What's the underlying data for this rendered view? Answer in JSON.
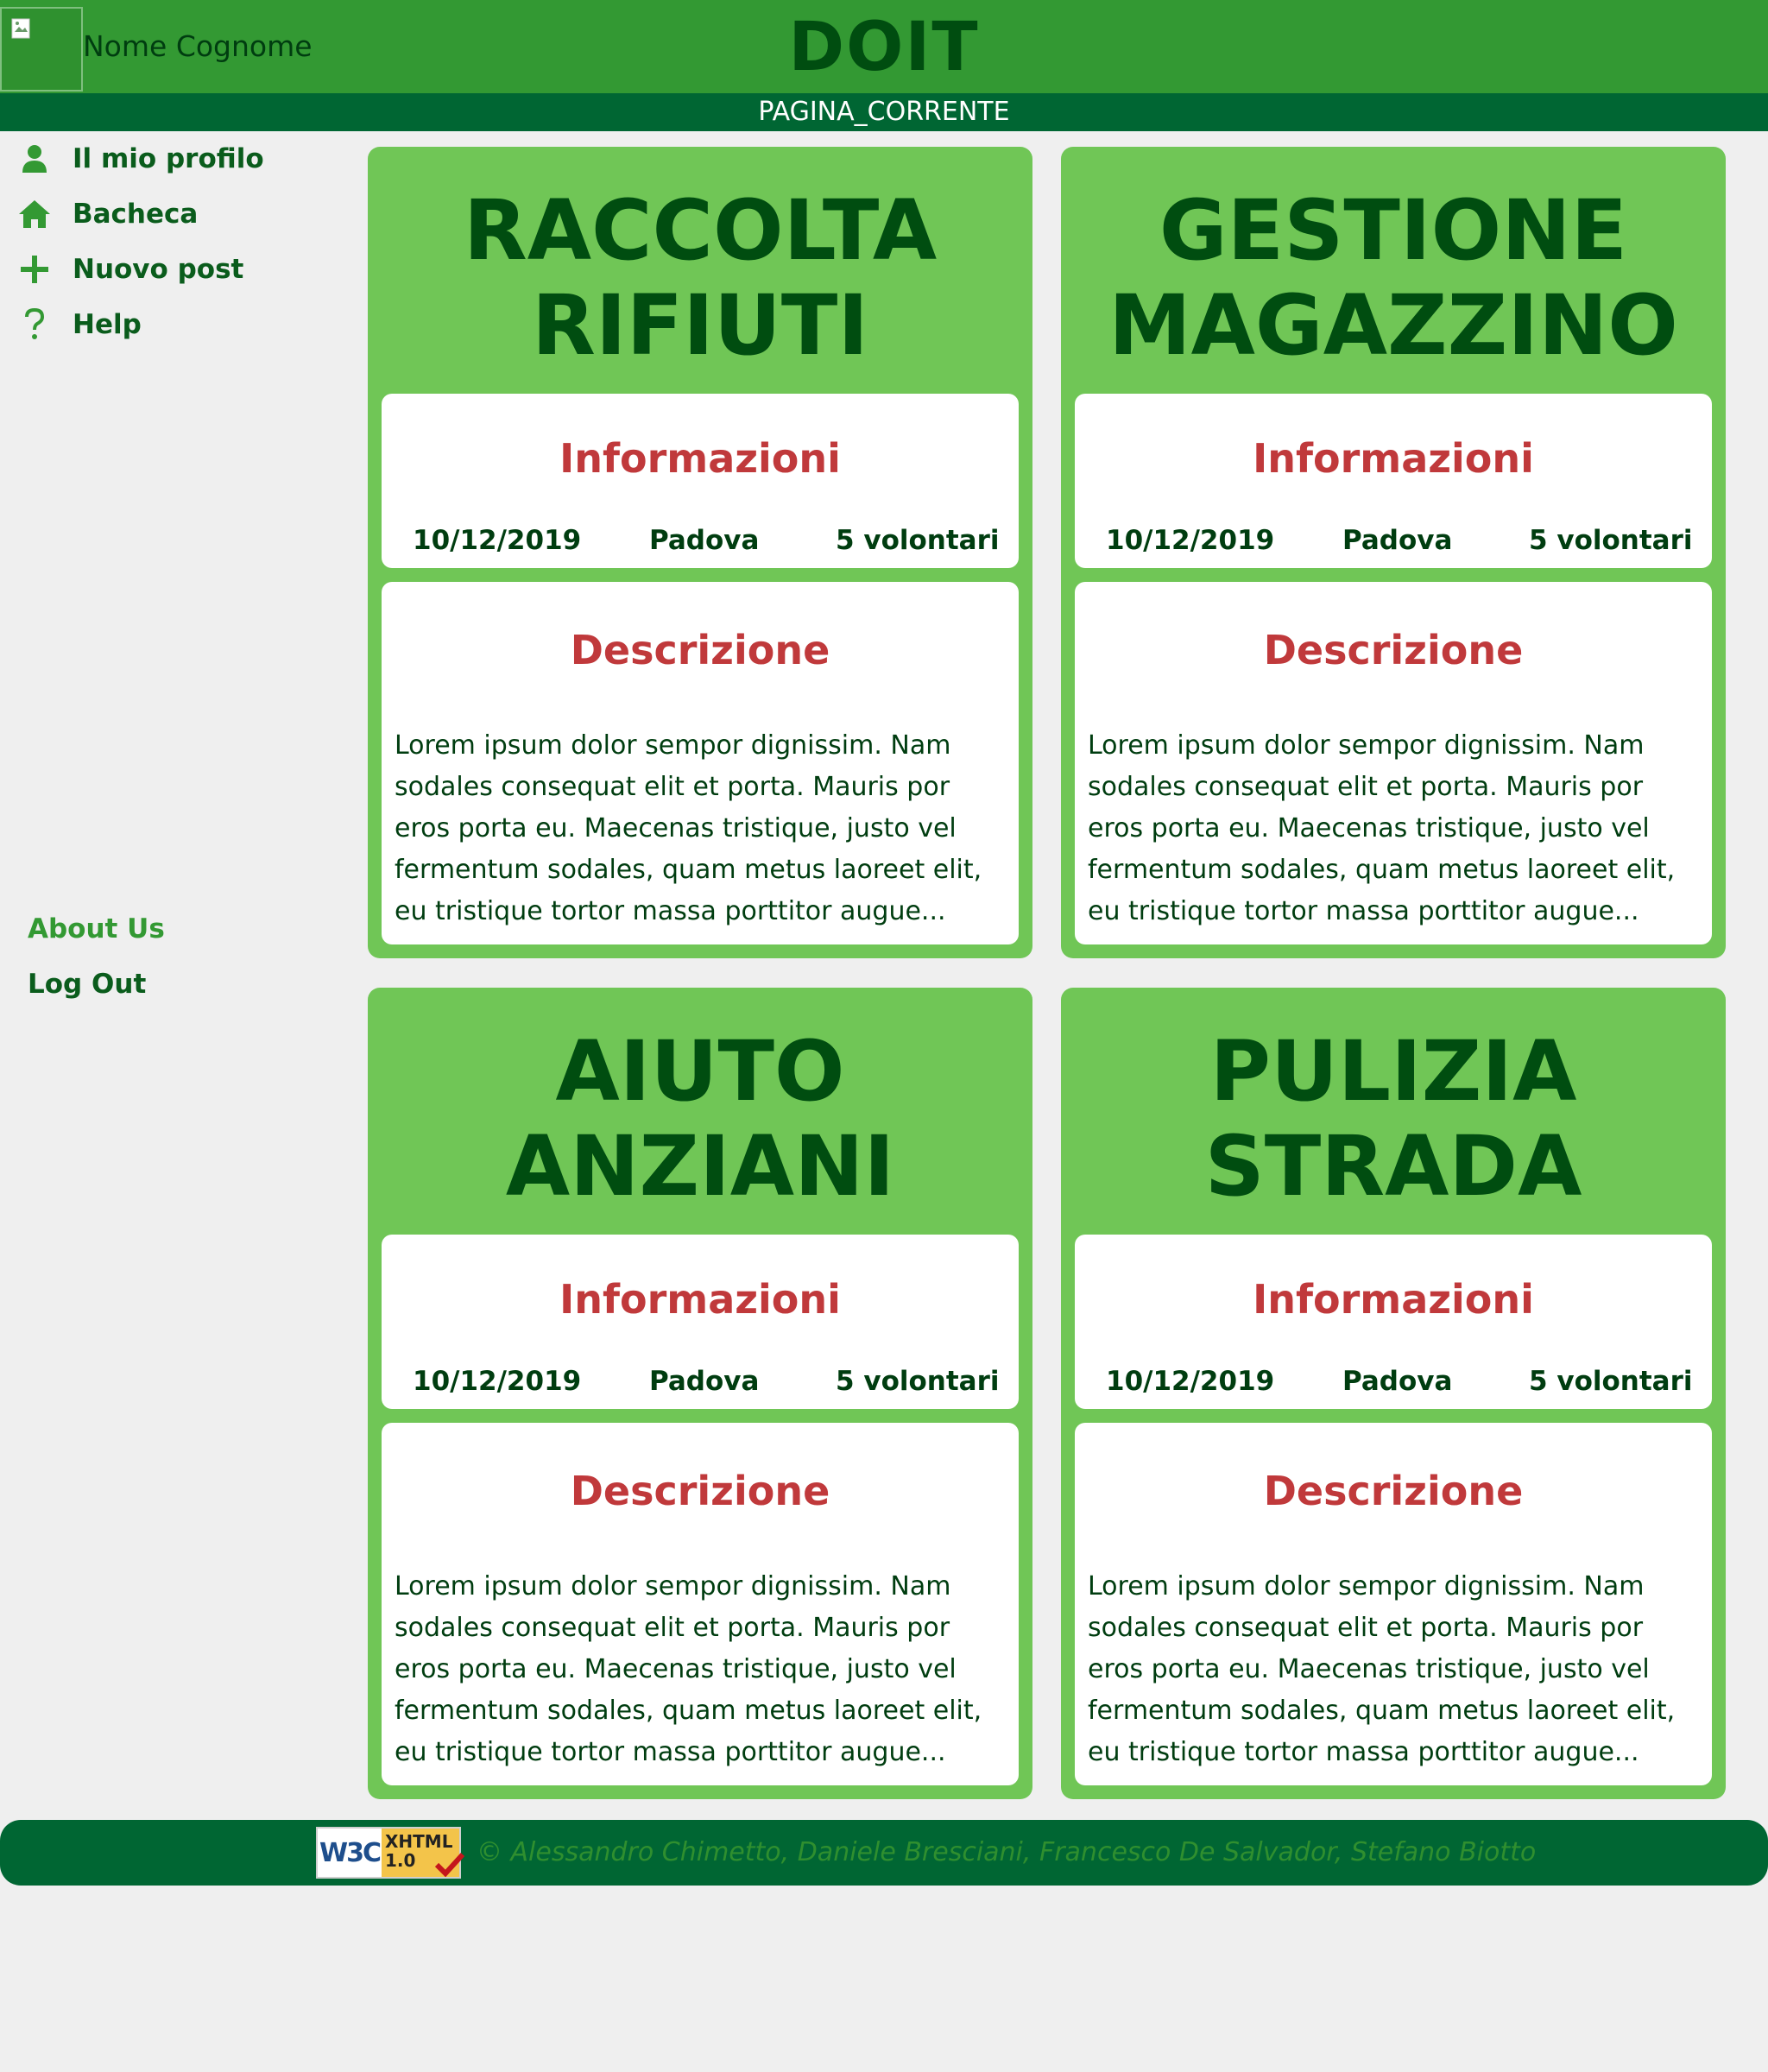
{
  "header": {
    "user_name": "Nome Cognome",
    "site_title": "DOIT",
    "current_page": "PAGINA_CORRENTE"
  },
  "sidebar": {
    "items": [
      {
        "label": "Il mio profilo",
        "icon": "user-icon"
      },
      {
        "label": "Bacheca",
        "icon": "home-icon"
      },
      {
        "label": "Nuovo post",
        "icon": "plus-icon"
      },
      {
        "label": "Help",
        "icon": "question-icon"
      }
    ],
    "about": "About Us",
    "logout": "Log Out"
  },
  "cards": [
    {
      "title_line1": "RACCOLTA",
      "title_line2": "RIFIUTI",
      "info_heading": "Informazioni",
      "date": "10/12/2019",
      "city": "Padova",
      "volunteers": "5 volontari",
      "desc_heading": "Descrizione",
      "description": "Lorem ipsum dolor sempor dignissim. Nam sodales consequat elit et porta. Mauris por eros porta eu. Maecenas tristique, justo vel fermentum sodales, quam metus laoreet elit, eu tristique tortor massa porttitor augue..."
    },
    {
      "title_line1": "GESTIONE",
      "title_line2": "MAGAZZINO",
      "info_heading": "Informazioni",
      "date": "10/12/2019",
      "city": "Padova",
      "volunteers": "5 volontari",
      "desc_heading": "Descrizione",
      "description": "Lorem ipsum dolor sempor dignissim. Nam sodales consequat elit et porta. Mauris por eros porta eu. Maecenas tristique, justo vel fermentum sodales, quam metus laoreet elit, eu tristique tortor massa porttitor augue..."
    },
    {
      "title_line1": "AIUTO",
      "title_line2": "ANZIANI",
      "info_heading": "Informazioni",
      "date": "10/12/2019",
      "city": "Padova",
      "volunteers": "5 volontari",
      "desc_heading": "Descrizione",
      "description": "Lorem ipsum dolor sempor dignissim. Nam sodales consequat elit et porta. Mauris por eros porta eu. Maecenas tristique, justo vel fermentum sodales, quam metus laoreet elit, eu tristique tortor massa porttitor augue..."
    },
    {
      "title_line1": "PULIZIA",
      "title_line2": "STRADA",
      "info_heading": "Informazioni",
      "date": "10/12/2019",
      "city": "Padova",
      "volunteers": "5 volontari",
      "desc_heading": "Descrizione",
      "description": "Lorem ipsum dolor sempor dignissim. Nam sodales consequat elit et porta. Mauris por eros porta eu. Maecenas tristique, justo vel fermentum sodales, quam metus laoreet elit, eu tristique tortor massa porttitor augue..."
    }
  ],
  "footer": {
    "badge_w3c": "W3C",
    "badge_xhtml": "XHTML",
    "badge_version": "1.0",
    "credits": "© Alessandro Chimetto, Daniele Bresciani, Francesco De Salvador, Stefano Biotto"
  },
  "colors": {
    "header_bg": "#339933",
    "subbar_bg": "#006633",
    "card_bg": "#70c656",
    "heading_red": "#c0393b",
    "text_dark": "#003d10"
  }
}
